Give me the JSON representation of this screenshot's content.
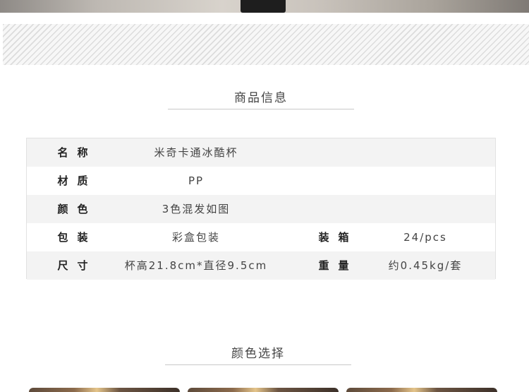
{
  "section_info": {
    "title": "商品信息"
  },
  "info_rows": [
    {
      "label": "名称",
      "value": "米奇卡通冰酷杯"
    },
    {
      "label": "材质",
      "value": "PP"
    },
    {
      "label": "颜色",
      "value": "3色混发如图"
    },
    {
      "label": "包装",
      "value": "彩盒包装",
      "label2": "装箱",
      "value2": "24/pcs"
    },
    {
      "label": "尺寸",
      "value": "杯高21.8cm*直径9.5cm",
      "label2": "重量",
      "value2": "约0.45kg/套"
    }
  ],
  "section_color": {
    "title": "颜色选择"
  }
}
